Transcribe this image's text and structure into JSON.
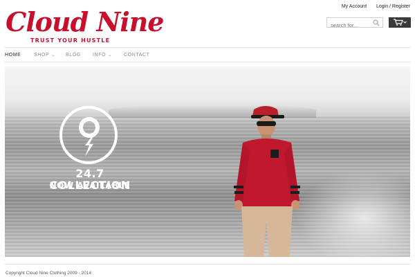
{
  "brand": {
    "name": "Cloud Nine",
    "tagline": "TRUST YOUR HUSTLE"
  },
  "account": {
    "my_account": "My Account",
    "login_register": "Login / Register"
  },
  "search": {
    "placeholder": "search for..."
  },
  "nav": {
    "items": [
      {
        "label": "HOME",
        "active": true
      },
      {
        "label": "SHOP",
        "dropdown": true
      },
      {
        "label": "BLOG"
      },
      {
        "label": "INFO",
        "dropdown": true
      },
      {
        "label": "CONTACT"
      }
    ],
    "caret": "⌄"
  },
  "hero": {
    "title": "24.7 COLLECTION",
    "subtitle": "NOW AVAILABLE"
  },
  "footer": {
    "copyright": "Copyright Cloud Nine Clothing 2009 - 2014"
  },
  "colors": {
    "brand_red": "#c8102e",
    "cart_bg": "#3a3a3a"
  },
  "icons": [
    "search-icon",
    "cart-icon",
    "cloud-nine-badge-icon"
  ]
}
